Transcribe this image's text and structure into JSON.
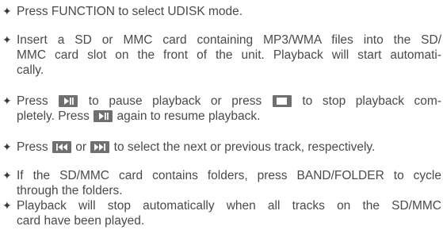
{
  "bullet_glyph": "✦",
  "items": [
    {
      "lines": [
        "Press FUNCTION to select UDISK mode."
      ]
    },
    {
      "lines": [
        "Insert a SD or MMC card containing MP3/WMA files into the SD/",
        "MMC card slot on the front of the unit. Playback will start automati-",
        "cally."
      ]
    },
    {
      "l1": {
        "a": "Press ",
        "b": " to pause playback or press ",
        "c": " to stop playback com-"
      },
      "l2": {
        "a": "pletely. Press ",
        "b": " again to resume playback."
      }
    },
    {
      "l1": {
        "a": "Press ",
        "b": " or ",
        "c": " to select the next or previous track, respectively."
      }
    },
    {
      "lines": [
        "If the SD/MMC card contains folders, press BAND/FOLDER to cycle",
        "through the folders."
      ]
    },
    {
      "lines": [
        "Playback will stop automatically when all tracks on the SD/MMC",
        "card have been played."
      ]
    }
  ],
  "icons": {
    "play_pause": "play-pause-icon",
    "stop": "stop-icon",
    "previous": "skip-back-icon",
    "next": "skip-forward-icon"
  },
  "colors": {
    "text": "#4a4a4a",
    "button": "#6f6f6f",
    "glyph": "#ffffff"
  }
}
